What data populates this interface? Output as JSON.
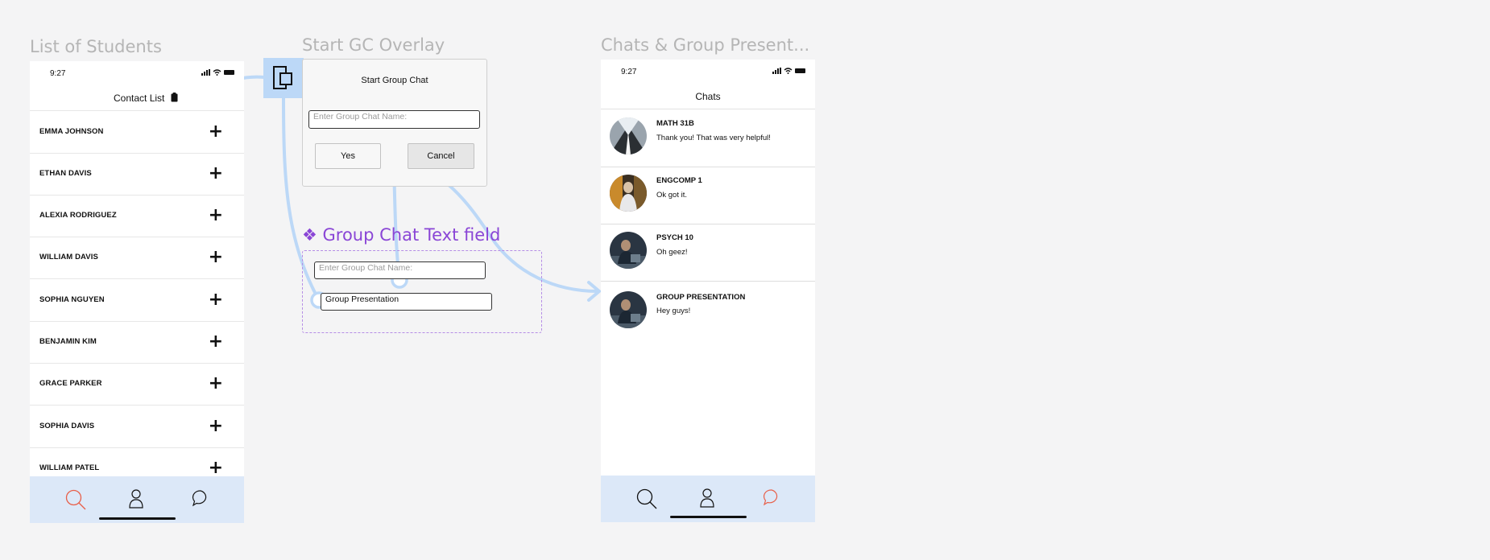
{
  "frames": {
    "list_title": "List of Students",
    "overlay_title": "Start GC Overlay",
    "chats_title": "Chats & Group Present..."
  },
  "contact_phone": {
    "time": "9:27",
    "header": "Contact List",
    "contacts": [
      "EMMA JOHNSON",
      "ETHAN DAVIS",
      "ALEXIA RODRIGUEZ",
      "WILLIAM DAVIS",
      "SOPHIA NGUYEN",
      "BENJAMIN KIM",
      "GRACE PARKER",
      "SOPHIA DAVIS",
      "WILLIAM PATEL"
    ],
    "add_glyph": "+"
  },
  "overlay": {
    "title": "Start Group Chat",
    "field_placeholder": "Enter Group Chat Name:",
    "yes_label": "Yes",
    "cancel_label": "Cancel"
  },
  "component": {
    "title": "❖ Group Chat Text field",
    "placeholder_field": "Enter Group Chat Name:",
    "filled_field": "Group Presentation"
  },
  "chats_phone": {
    "time": "9:27",
    "header": "Chats",
    "chats": [
      {
        "title": "MATH 31B",
        "message": "Thank you! That was very helpful!"
      },
      {
        "title": "ENGCOMP 1",
        "message": "Ok got it."
      },
      {
        "title": "PSYCH 10",
        "message": "Oh geez!"
      },
      {
        "title": "GROUP PRESENTATION",
        "message": "Hey guys!"
      }
    ]
  },
  "colors": {
    "connector": "#bcd8f7",
    "tabbar": "#dce8f8",
    "active_tab": "#e8604a",
    "component_purple": "#8a46d6"
  },
  "icons": {
    "tabs": [
      "search-icon",
      "profile-icon",
      "chat-bubble-icon"
    ],
    "header": "clipboard-icon",
    "node": "navigate-overlay-icon"
  }
}
